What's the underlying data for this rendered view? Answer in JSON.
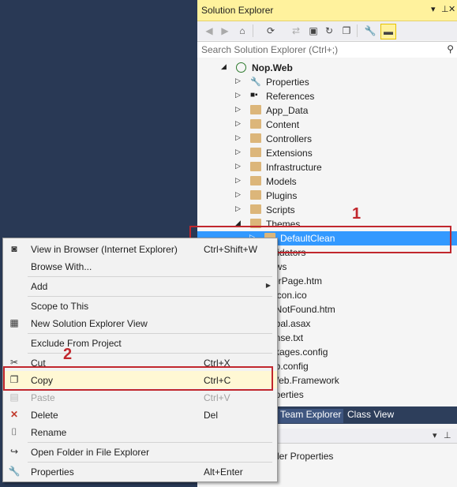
{
  "solution_explorer": {
    "title": "Solution Explorer",
    "search_placeholder": "Search Solution Explorer (Ctrl+;)",
    "tree": {
      "root": "Nop.Web",
      "items": [
        "Properties",
        "References",
        "App_Data",
        "Content",
        "Controllers",
        "Extensions",
        "Infrastructure",
        "Models",
        "Plugins",
        "Scripts",
        "Themes"
      ],
      "selected": "DefaultClean",
      "partial_items": [
        "alidators",
        "ews",
        "rorPage.htm",
        "vicon.ico",
        "eNotFound.htm",
        "obal.asax",
        "ense.txt",
        "ckages.config",
        "eb.config",
        "Web.Framework",
        "operties"
      ]
    }
  },
  "bottom_tabs": [
    "Team Explorer",
    "Class View"
  ],
  "properties_panel": {
    "text": "der Properties"
  },
  "annotations": {
    "n1": "1",
    "n2": "2",
    "accent": "#c1272d"
  },
  "context_menu": {
    "view_in_browser": {
      "label": "View in Browser (Internet Explorer)",
      "shortcut": "Ctrl+Shift+W"
    },
    "browse_with": {
      "label": "Browse With..."
    },
    "add": {
      "label": "Add"
    },
    "scope_to_this": {
      "label": "Scope to This"
    },
    "new_view": {
      "label": "New Solution Explorer View"
    },
    "exclude": {
      "label": "Exclude From Project"
    },
    "cut": {
      "label": "Cut",
      "shortcut": "Ctrl+X"
    },
    "copy": {
      "label": "Copy",
      "shortcut": "Ctrl+C"
    },
    "paste": {
      "label": "Paste",
      "shortcut": "Ctrl+V"
    },
    "delete": {
      "label": "Delete",
      "shortcut": "Del"
    },
    "rename": {
      "label": "Rename"
    },
    "open_folder": {
      "label": "Open Folder in File Explorer"
    },
    "properties": {
      "label": "Properties",
      "shortcut": "Alt+Enter"
    }
  }
}
